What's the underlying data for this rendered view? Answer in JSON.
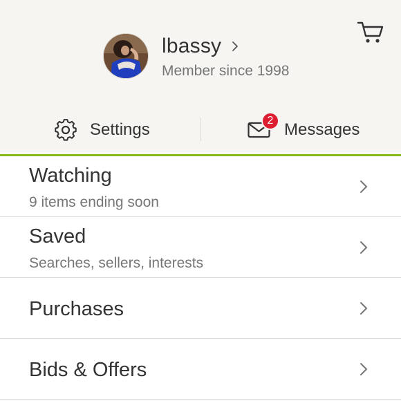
{
  "profile": {
    "username": "lbassy",
    "member_since": "Member since 1998"
  },
  "tabs": {
    "settings_label": "Settings",
    "messages_label": "Messages",
    "messages_badge": "2"
  },
  "menu": [
    {
      "title": "Watching",
      "subtitle": "9 items ending soon"
    },
    {
      "title": "Saved",
      "subtitle": "Searches, sellers, interests"
    },
    {
      "title": "Purchases"
    },
    {
      "title": "Bids & Offers"
    }
  ],
  "icons": {
    "cart": "cart-icon",
    "settings": "gear-icon",
    "messages": "envelope-icon",
    "chevron": "chevron-right-icon"
  },
  "colors": {
    "accent": "#86b817",
    "badge": "#dd1e31",
    "header_bg": "#f6f5f2",
    "text_primary": "#333333",
    "text_secondary": "#767676"
  }
}
